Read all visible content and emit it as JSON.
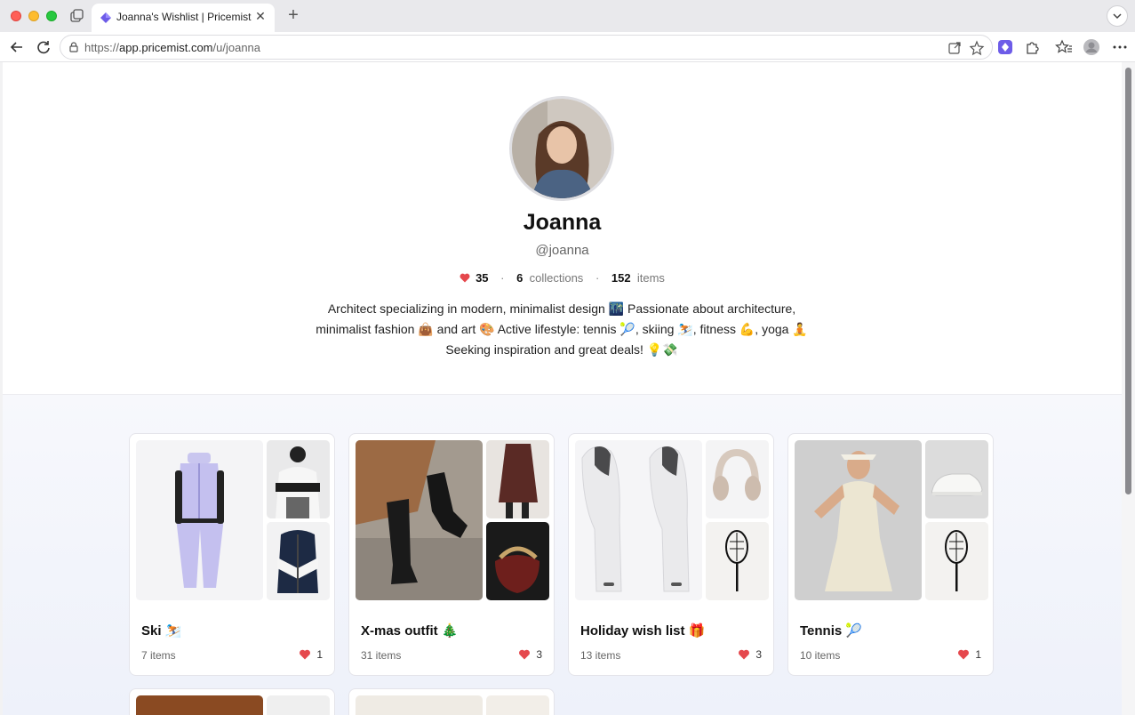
{
  "browser": {
    "tab_title": "Joanna's Wishlist | Pricemist",
    "url_prefix": "https://",
    "url_host": "app.pricemist.com",
    "url_path": "/u/joanna"
  },
  "profile": {
    "name": "Joanna",
    "handle": "@joanna",
    "likes": "35",
    "collections_count": "6",
    "collections_label": "collections",
    "items_count": "152",
    "items_label": "items",
    "bio_line1": "Architect specializing in modern, minimalist design 🌃 Passionate about architecture,",
    "bio_line2": "minimalist fashion 👜 and art 🎨 Active lifestyle: tennis 🎾, skiing ⛷️, fitness 💪, yoga 🧘",
    "bio_line3": "Seeking inspiration and great deals! 💡💸"
  },
  "collections": [
    {
      "title": "Ski ⛷️",
      "count": "7 items",
      "likes": "1"
    },
    {
      "title": "X-mas outfit 🎄",
      "count": "31 items",
      "likes": "3"
    },
    {
      "title": "Holiday wish list 🎁",
      "count": "13 items",
      "likes": "3"
    },
    {
      "title": "Tennis 🎾",
      "count": "10 items",
      "likes": "1"
    }
  ],
  "colors": {
    "heart": "#e5484d",
    "accent": "#6d5ce8"
  }
}
